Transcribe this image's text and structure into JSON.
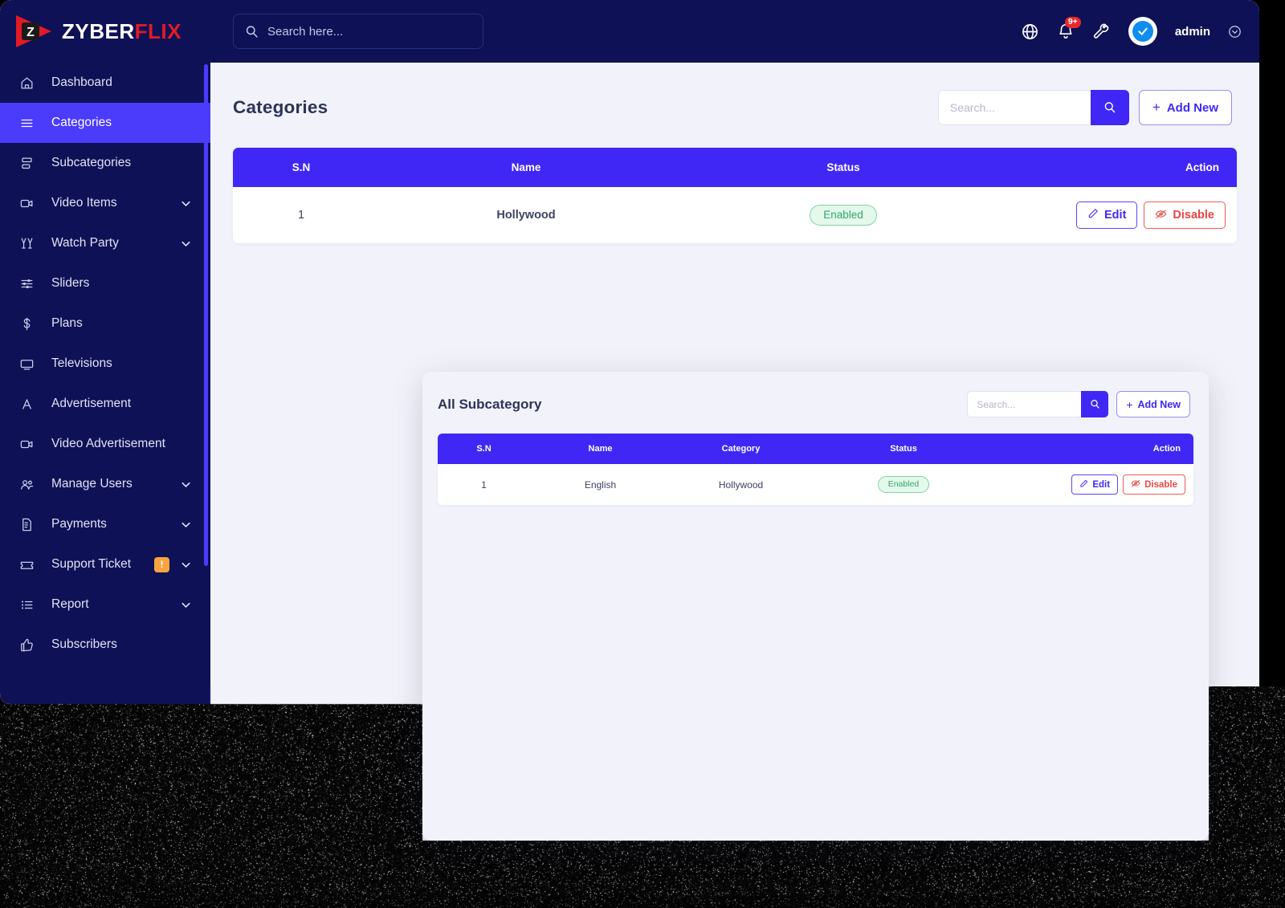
{
  "brand": {
    "name_primary": "ZYBER",
    "name_accent": "FLIX",
    "mark": "play-logo"
  },
  "topbar": {
    "search_placeholder": "Search here...",
    "search_value": "",
    "icons": [
      "globe-icon",
      "bell-icon",
      "wrench-icon"
    ],
    "notification_badge": "9+",
    "user_name": "admin",
    "avatar": "verified-check-avatar"
  },
  "sidebar": {
    "items": [
      {
        "label": "Dashboard",
        "icon": "home-icon",
        "active": false,
        "chevron": false,
        "badge": null
      },
      {
        "label": "Categories",
        "icon": "menu-lines-icon",
        "active": true,
        "chevron": false,
        "badge": null
      },
      {
        "label": "Subcategories",
        "icon": "layers-icon",
        "active": false,
        "chevron": false,
        "badge": null
      },
      {
        "label": "Video Items",
        "icon": "video-camera-icon",
        "active": false,
        "chevron": true,
        "badge": null
      },
      {
        "label": "Watch Party",
        "icon": "cheers-glasses-icon",
        "active": false,
        "chevron": true,
        "badge": null
      },
      {
        "label": "Sliders",
        "icon": "sliders-icon",
        "active": false,
        "chevron": false,
        "badge": null
      },
      {
        "label": "Plans",
        "icon": "dollar-icon",
        "active": false,
        "chevron": false,
        "badge": null
      },
      {
        "label": "Televisions",
        "icon": "tv-icon",
        "active": false,
        "chevron": false,
        "badge": null
      },
      {
        "label": "Advertisement",
        "icon": "letter-a-icon",
        "active": false,
        "chevron": false,
        "badge": null
      },
      {
        "label": "Video Advertisement",
        "icon": "video-camera-icon",
        "active": false,
        "chevron": false,
        "badge": null
      },
      {
        "label": "Manage Users",
        "icon": "users-group-icon",
        "active": false,
        "chevron": true,
        "badge": null
      },
      {
        "label": "Payments",
        "icon": "invoice-dollar-icon",
        "active": false,
        "chevron": true,
        "badge": null
      },
      {
        "label": "Support Ticket",
        "icon": "ticket-icon",
        "active": false,
        "chevron": true,
        "badge": "!"
      },
      {
        "label": "Report",
        "icon": "list-checks-icon",
        "active": false,
        "chevron": true,
        "badge": null
      },
      {
        "label": "Subscribers",
        "icon": "thumbs-up-icon",
        "active": false,
        "chevron": false,
        "badge": null
      }
    ]
  },
  "page": {
    "title": "Categories",
    "search_placeholder": "Search...",
    "search_value": "",
    "search_icon": "magnifier-icon",
    "add_new_label": "Add New",
    "add_new_plus": "+",
    "table": {
      "headers": [
        "S.N",
        "Name",
        "Status",
        "Action"
      ],
      "rows": [
        {
          "sn": "1",
          "name": "Hollywood",
          "status": "Enabled",
          "edit_label": "Edit",
          "disable_label": "Disable"
        }
      ]
    }
  },
  "subcategory_panel": {
    "title": "All Subcategory",
    "search_placeholder": "Search...",
    "search_value": "",
    "search_icon": "magnifier-icon",
    "add_new_label": "Add New",
    "add_new_plus": "+",
    "table": {
      "headers": [
        "S.N",
        "Name",
        "Category",
        "Status",
        "Action"
      ],
      "rows": [
        {
          "sn": "1",
          "name": "English",
          "category": "Hollywood",
          "status": "Enabled",
          "edit_label": "Edit",
          "disable_label": "Disable"
        }
      ]
    }
  },
  "colors": {
    "sidebar_bg": "#0f1156",
    "accent_blue": "#4027f5",
    "active_nav": "#4b3bfb",
    "brand_red": "#e01b24",
    "status_green": "#2fa96a",
    "danger_red": "#ec4545",
    "badge_orange": "#f7a440",
    "page_bg": "#f2f3fa"
  }
}
